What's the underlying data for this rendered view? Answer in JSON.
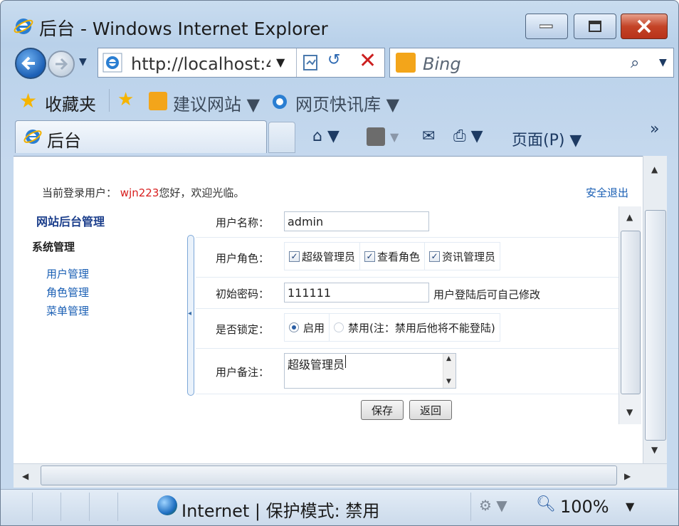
{
  "window": {
    "title": "后台 - Windows Internet Explorer"
  },
  "address": {
    "url": "http://localhost:4",
    "search_engine": "Bing"
  },
  "favorites": {
    "label": "收藏夹",
    "items": [
      "建议网站 ▼",
      "网页快讯库 ▼"
    ]
  },
  "tab": {
    "label": "后台"
  },
  "commands": {
    "page_menu": "页面(P) ▼",
    "more": "»"
  },
  "page": {
    "login_prefix": "当前登录用户：",
    "login_user": "wjn223",
    "login_suffix": "您好，欢迎光临。",
    "logout": "安全退出",
    "sidebar": {
      "title": "网站后台管理",
      "section": "系统管理",
      "links": [
        "用户管理",
        "角色管理",
        "菜单管理"
      ]
    },
    "form": {
      "username_label": "用户名称：",
      "username_value": "admin",
      "role_label": "用户角色：",
      "roles": [
        "超级管理员",
        "查看角色",
        "资讯管理员"
      ],
      "password_label": "初始密码：",
      "password_value": "111111",
      "password_hint": "用户登陆后可自己修改",
      "locked_label": "是否锁定：",
      "locked_options": [
        "启用",
        "禁用(注：禁用后他将不能登陆)"
      ],
      "locked_selected": "启用",
      "note_label": "用户备注：",
      "note_value": "超级管理员",
      "save_button": "保存",
      "back_button": "返回"
    }
  },
  "status": {
    "zone": "Internet | 保护模式: 禁用",
    "zoom": "100%"
  },
  "colors": {
    "accent": "#1a5fb4",
    "username_red": "#d81e1e",
    "close_button": "#c44427"
  }
}
